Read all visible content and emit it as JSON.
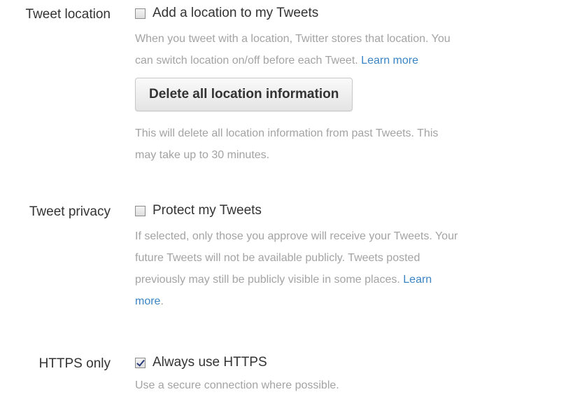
{
  "location": {
    "label": "Tweet location",
    "checkbox_label": "Add a location to my Tweets",
    "checked": false,
    "help_line1": "When you tweet with a location, Twitter stores that location. You",
    "help_line2": "can switch location on/off before each Tweet.",
    "learn_more": "Learn more",
    "delete_button": "Delete all location information",
    "delete_help_line1": "This will delete all location information from past Tweets. This",
    "delete_help_line2": "may take up to 30 minutes."
  },
  "privacy": {
    "label": "Tweet privacy",
    "checkbox_label": "Protect my Tweets",
    "checked": false,
    "help_line1": "If selected, only those you approve will receive your Tweets. Your",
    "help_line2": "future Tweets will not be available publicly. Tweets posted",
    "help_line3": "previously may still be publicly visible in some places.",
    "learn_more_part1": "Learn",
    "learn_more_part2": "more",
    "help_end": "."
  },
  "https": {
    "label": "HTTPS only",
    "checkbox_label": "Always use HTTPS",
    "checked": true,
    "help": "Use a secure connection where possible."
  },
  "colors": {
    "text": "#333333",
    "help_text": "#a3a3a3",
    "link": "#3a84c4"
  }
}
